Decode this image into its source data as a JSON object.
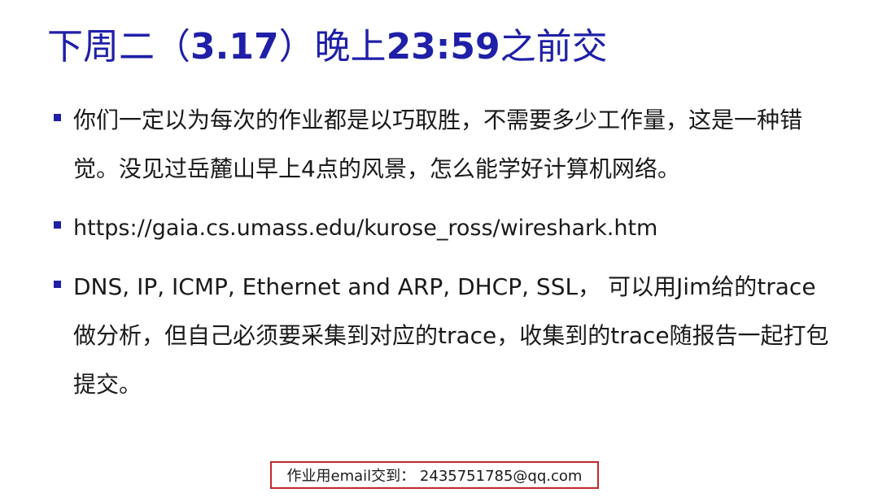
{
  "title": {
    "prefix": "下周二（",
    "date": "3.17",
    "middle": "）晚上",
    "time": "23:59",
    "suffix": "之前交"
  },
  "bullets": [
    "你们一定以为每次的作业都是以巧取胜，不需要多少工作量，这是一种错觉。没见过岳麓山早上4点的风景，怎么能学好计算机网络。",
    "https://gaia.cs.umass.edu/kurose_ross/wireshark.htm",
    "DNS, IP, ICMP, Ethernet and ARP, DHCP, SSL， 可以用Jim给的trace做分析，但自己必须要采集到对应的trace，收集到的trace随报告一起打包提交。"
  ],
  "footer": {
    "text": "作业用email交到：  2435751785@qq.com"
  },
  "colors": {
    "title": "#1f1fa8",
    "bullet_marker": "#1f1fa8",
    "footer_border": "#c0282d"
  }
}
